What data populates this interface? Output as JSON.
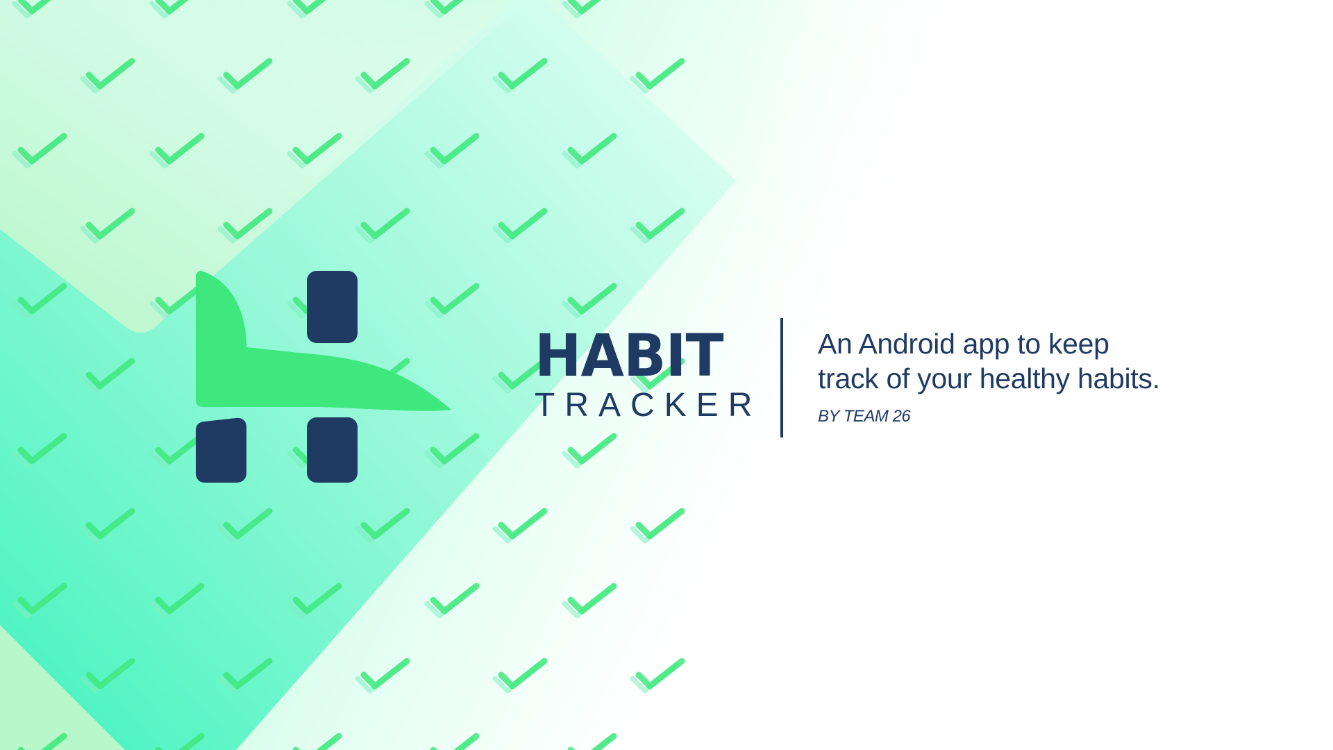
{
  "brand": {
    "name_line1": "HABIT",
    "name_line2": "TRACKER",
    "logo_icon": "habit-tracker-h-logo",
    "colors": {
      "navy": "#1f3a63",
      "green": "#3ee87d",
      "mint": "#4cf7c4",
      "light_mint": "#c9fbe0"
    }
  },
  "tagline": {
    "line1": "An Android app to keep",
    "line2": "track of your healthy habits.",
    "byline": "BY TEAM 26"
  },
  "background": {
    "pattern_icon": "checkmark-icon"
  }
}
